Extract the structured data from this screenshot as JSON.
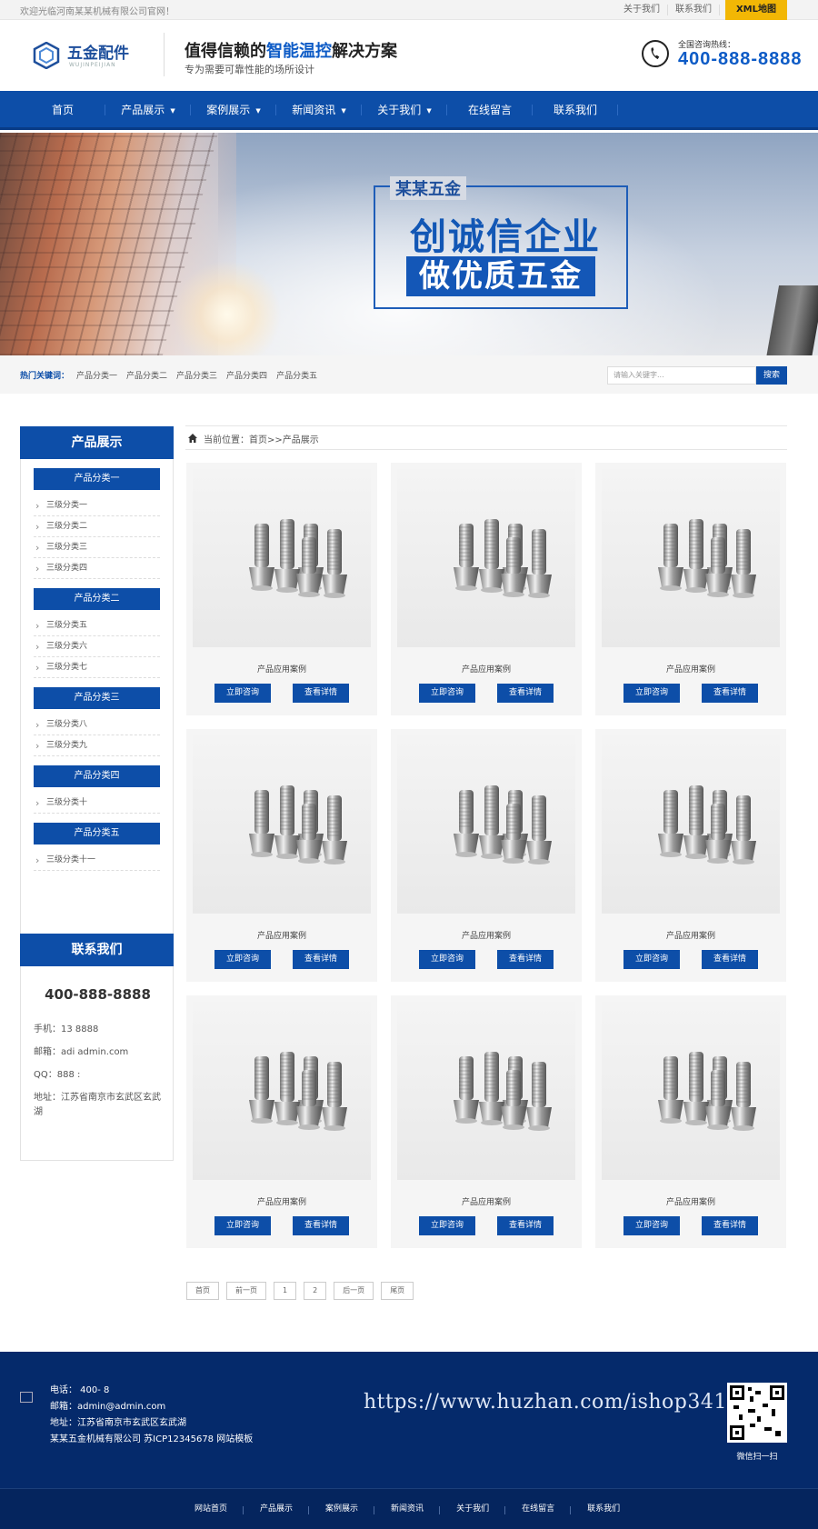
{
  "topbar": {
    "welcome": "欢迎光临河南某某机械有限公司官网！",
    "links": [
      "关于我们",
      "联系我们"
    ],
    "xml": "XML地图"
  },
  "header": {
    "logo_text": "五金配件",
    "logo_sub": "WUJINPEIJIAN",
    "slogan_pre": "值得信赖的",
    "slogan_em": "智能温控",
    "slogan_post": "解决方案",
    "slogan_sub": "专为需要可靠性能的场所设计",
    "hotline_label": "全国咨询热线：",
    "hotline_number": "400-888-8888"
  },
  "nav": [
    {
      "label": "首页",
      "dropdown": false
    },
    {
      "label": "产品展示",
      "dropdown": true
    },
    {
      "label": "案例展示",
      "dropdown": true
    },
    {
      "label": "新闻资讯",
      "dropdown": true
    },
    {
      "label": "关于我们",
      "dropdown": true
    },
    {
      "label": "在线留言",
      "dropdown": false
    },
    {
      "label": "联系我们",
      "dropdown": false
    }
  ],
  "banner": {
    "tag": "某某五金",
    "line1": "创诚信企业",
    "line2": "做优质五金"
  },
  "keywords": {
    "label": "热门关键词：",
    "items": [
      "产品分类一",
      "产品分类二",
      "产品分类三",
      "产品分类四",
      "产品分类五"
    ],
    "search_placeholder": "请输入关键字...",
    "search_button": "搜索"
  },
  "sidebar": {
    "title": "产品展示",
    "groups": [
      {
        "name": "产品分类一",
        "items": [
          "三级分类一",
          "三级分类二",
          "三级分类三",
          "三级分类四"
        ]
      },
      {
        "name": "产品分类二",
        "items": [
          "三级分类五",
          "三级分类六",
          "三级分类七"
        ]
      },
      {
        "name": "产品分类三",
        "items": [
          "三级分类八",
          "三级分类九"
        ]
      },
      {
        "name": "产品分类四",
        "items": [
          "三级分类十"
        ]
      },
      {
        "name": "产品分类五",
        "items": [
          "三级分类十一"
        ]
      }
    ]
  },
  "contact": {
    "title": "联系我们",
    "tel": "400-888-8888",
    "mobile": "手机：13        8888",
    "email": "邮箱：adi        admin.com",
    "qq": "QQ：888          :",
    "address": "地址：江苏省南京市玄武区玄武湖"
  },
  "breadcrumb": "当前位置：首页>>产品展示",
  "products": {
    "name": "产品应用案例",
    "consult": "立即咨询",
    "detail": "查看详情",
    "count": 9
  },
  "pager": [
    "首页",
    "前一页",
    "1",
    "2",
    "后一页",
    "尾页"
  ],
  "footer": {
    "tel": "电话：  400-          8",
    "email": "邮箱：admin@admin.com",
    "address": "地址：江苏省南京市玄武区玄武湖",
    "copyright": "某某五金机械有限公司 苏ICP12345678 网站模板",
    "watermark": "https://www.huzhan.com/ishop34101",
    "qr_label": "微信扫一扫"
  },
  "footer_nav": [
    "网站首页",
    "产品展示",
    "案例展示",
    "新闻资讯",
    "关于我们",
    "在线留言",
    "联系我们"
  ],
  "colors": {
    "primary": "#0d4ea8",
    "accent": "#f2b705",
    "footer": "#052a6b"
  }
}
